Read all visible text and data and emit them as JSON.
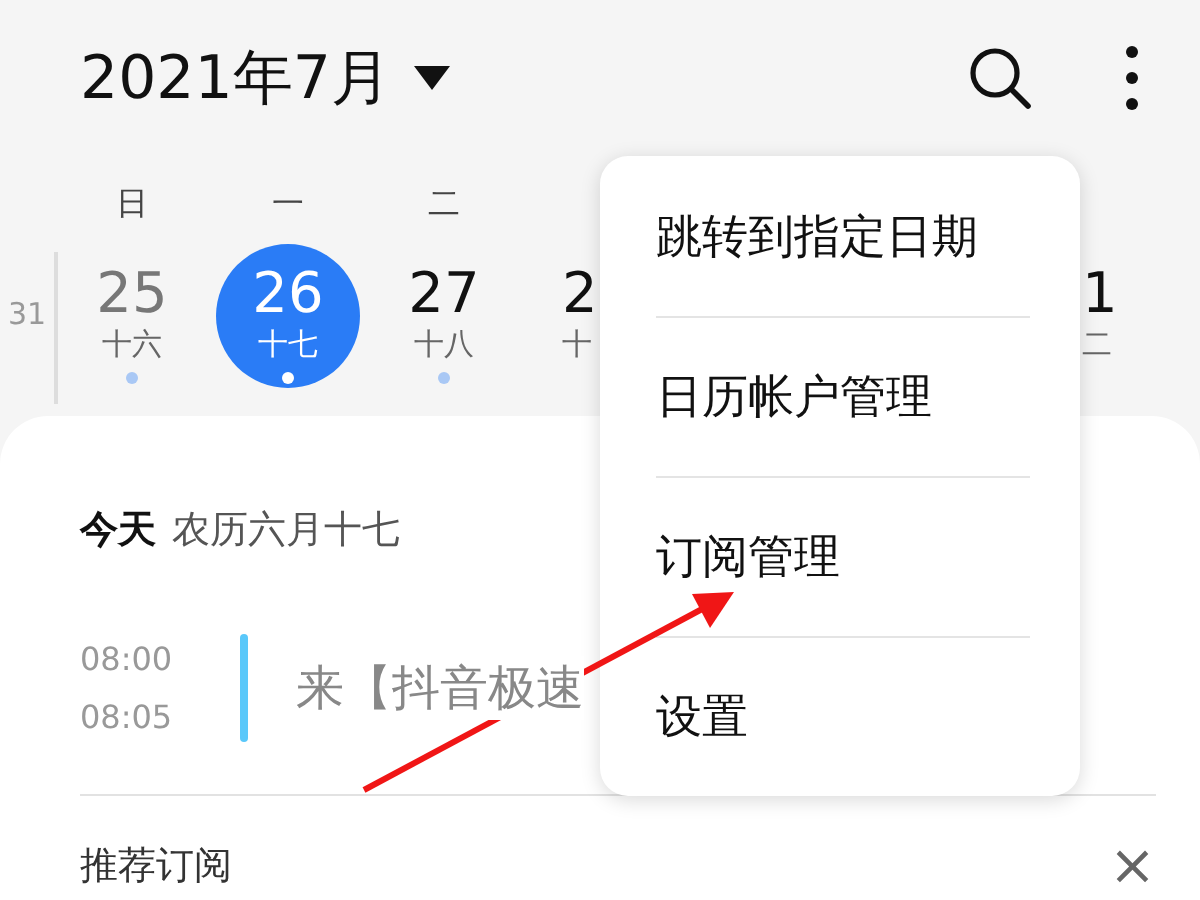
{
  "header": {
    "title": "2021年7月"
  },
  "week": {
    "number": "31",
    "weekdays": [
      "日",
      "一",
      "二"
    ],
    "days": [
      {
        "date": "25",
        "lunar": "十六",
        "selected": false,
        "has_event": true
      },
      {
        "date": "26",
        "lunar": "十七",
        "selected": true,
        "has_event": true
      },
      {
        "date": "27",
        "lunar": "十八",
        "selected": false,
        "has_event": true
      },
      {
        "date": "2",
        "lunar": "十",
        "selected": false,
        "has_event": false
      },
      {
        "date": "1",
        "lunar": "二",
        "selected": false,
        "has_event": false
      }
    ]
  },
  "today": {
    "label": "今天",
    "lunar_date": "农历六月十七"
  },
  "events": [
    {
      "start": "08:00",
      "end": "08:05",
      "title": "来【抖音极速"
    }
  ],
  "recommend": {
    "title": "推荐订阅",
    "close": "×"
  },
  "menu": {
    "items": [
      "跳转到指定日期",
      "日历帐户管理",
      "订阅管理",
      "设置"
    ]
  }
}
